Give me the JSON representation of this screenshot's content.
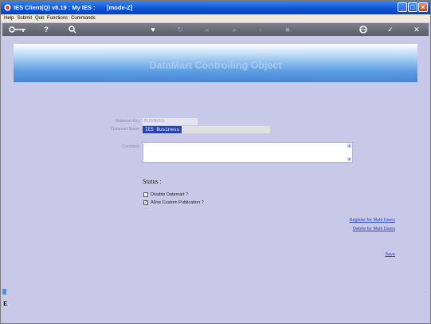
{
  "window": {
    "title": "IES Client(Q) v8.19 : My IES :       [mode-Z]",
    "title_icon": "ies-app-icon",
    "buttons": {
      "minimize": "minimize-icon",
      "maximize": "maximize-icon",
      "close": "close-icon"
    }
  },
  "menu": {
    "items": [
      "Help",
      "Submit",
      "Quit",
      "Functions",
      "Commands"
    ]
  },
  "toolbar": {
    "icons": [
      "key-icon",
      "help-icon",
      "search-icon",
      "heart-icon",
      "refresh-icon",
      "rewind-icon",
      "fast-forward-icon",
      "next-icon",
      "stop-icon",
      "globe-icon",
      "check-icon",
      "close-icon"
    ]
  },
  "banner": {
    "title": "DataMart Controlling Object"
  },
  "form": {
    "datamart_key_label": "Datamart Key",
    "datamart_key_value": "BUSINESS",
    "datamart_name_label": "Datamart Name",
    "datamart_name_value": "IES Business",
    "comment_label": "Comment",
    "comment_value": ""
  },
  "status": {
    "label": "Status :"
  },
  "options": {
    "disable_datamart": {
      "label": "Disable Datamart ?",
      "checked": false
    },
    "allow_custom_publication": {
      "label": "Allow Custom Publication ?",
      "checked": true
    }
  },
  "links": {
    "register": "Register for Multi Users",
    "delete": "Delete for Multi Users",
    "save": "Save"
  },
  "side": {
    "letter": "E"
  },
  "colors": {
    "titlebar": "#0a54d6",
    "background": "#c8c8e8",
    "banner": "#5e9fe2",
    "link": "#2640c8",
    "selection": "#2a43a8"
  }
}
